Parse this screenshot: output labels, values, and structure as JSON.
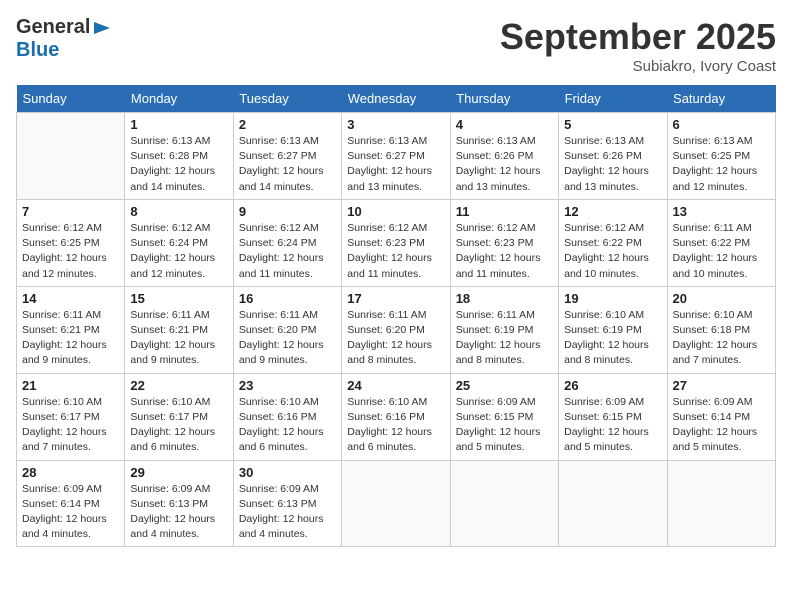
{
  "header": {
    "logo_general": "General",
    "logo_blue": "Blue",
    "month": "September 2025",
    "location": "Subiakro, Ivory Coast"
  },
  "weekdays": [
    "Sunday",
    "Monday",
    "Tuesday",
    "Wednesday",
    "Thursday",
    "Friday",
    "Saturday"
  ],
  "weeks": [
    [
      {
        "day": "",
        "info": ""
      },
      {
        "day": "1",
        "info": "Sunrise: 6:13 AM\nSunset: 6:28 PM\nDaylight: 12 hours\nand 14 minutes."
      },
      {
        "day": "2",
        "info": "Sunrise: 6:13 AM\nSunset: 6:27 PM\nDaylight: 12 hours\nand 14 minutes."
      },
      {
        "day": "3",
        "info": "Sunrise: 6:13 AM\nSunset: 6:27 PM\nDaylight: 12 hours\nand 13 minutes."
      },
      {
        "day": "4",
        "info": "Sunrise: 6:13 AM\nSunset: 6:26 PM\nDaylight: 12 hours\nand 13 minutes."
      },
      {
        "day": "5",
        "info": "Sunrise: 6:13 AM\nSunset: 6:26 PM\nDaylight: 12 hours\nand 13 minutes."
      },
      {
        "day": "6",
        "info": "Sunrise: 6:13 AM\nSunset: 6:25 PM\nDaylight: 12 hours\nand 12 minutes."
      }
    ],
    [
      {
        "day": "7",
        "info": "Sunrise: 6:12 AM\nSunset: 6:25 PM\nDaylight: 12 hours\nand 12 minutes."
      },
      {
        "day": "8",
        "info": "Sunrise: 6:12 AM\nSunset: 6:24 PM\nDaylight: 12 hours\nand 12 minutes."
      },
      {
        "day": "9",
        "info": "Sunrise: 6:12 AM\nSunset: 6:24 PM\nDaylight: 12 hours\nand 11 minutes."
      },
      {
        "day": "10",
        "info": "Sunrise: 6:12 AM\nSunset: 6:23 PM\nDaylight: 12 hours\nand 11 minutes."
      },
      {
        "day": "11",
        "info": "Sunrise: 6:12 AM\nSunset: 6:23 PM\nDaylight: 12 hours\nand 11 minutes."
      },
      {
        "day": "12",
        "info": "Sunrise: 6:12 AM\nSunset: 6:22 PM\nDaylight: 12 hours\nand 10 minutes."
      },
      {
        "day": "13",
        "info": "Sunrise: 6:11 AM\nSunset: 6:22 PM\nDaylight: 12 hours\nand 10 minutes."
      }
    ],
    [
      {
        "day": "14",
        "info": "Sunrise: 6:11 AM\nSunset: 6:21 PM\nDaylight: 12 hours\nand 9 minutes."
      },
      {
        "day": "15",
        "info": "Sunrise: 6:11 AM\nSunset: 6:21 PM\nDaylight: 12 hours\nand 9 minutes."
      },
      {
        "day": "16",
        "info": "Sunrise: 6:11 AM\nSunset: 6:20 PM\nDaylight: 12 hours\nand 9 minutes."
      },
      {
        "day": "17",
        "info": "Sunrise: 6:11 AM\nSunset: 6:20 PM\nDaylight: 12 hours\nand 8 minutes."
      },
      {
        "day": "18",
        "info": "Sunrise: 6:11 AM\nSunset: 6:19 PM\nDaylight: 12 hours\nand 8 minutes."
      },
      {
        "day": "19",
        "info": "Sunrise: 6:10 AM\nSunset: 6:19 PM\nDaylight: 12 hours\nand 8 minutes."
      },
      {
        "day": "20",
        "info": "Sunrise: 6:10 AM\nSunset: 6:18 PM\nDaylight: 12 hours\nand 7 minutes."
      }
    ],
    [
      {
        "day": "21",
        "info": "Sunrise: 6:10 AM\nSunset: 6:17 PM\nDaylight: 12 hours\nand 7 minutes."
      },
      {
        "day": "22",
        "info": "Sunrise: 6:10 AM\nSunset: 6:17 PM\nDaylight: 12 hours\nand 6 minutes."
      },
      {
        "day": "23",
        "info": "Sunrise: 6:10 AM\nSunset: 6:16 PM\nDaylight: 12 hours\nand 6 minutes."
      },
      {
        "day": "24",
        "info": "Sunrise: 6:10 AM\nSunset: 6:16 PM\nDaylight: 12 hours\nand 6 minutes."
      },
      {
        "day": "25",
        "info": "Sunrise: 6:09 AM\nSunset: 6:15 PM\nDaylight: 12 hours\nand 5 minutes."
      },
      {
        "day": "26",
        "info": "Sunrise: 6:09 AM\nSunset: 6:15 PM\nDaylight: 12 hours\nand 5 minutes."
      },
      {
        "day": "27",
        "info": "Sunrise: 6:09 AM\nSunset: 6:14 PM\nDaylight: 12 hours\nand 5 minutes."
      }
    ],
    [
      {
        "day": "28",
        "info": "Sunrise: 6:09 AM\nSunset: 6:14 PM\nDaylight: 12 hours\nand 4 minutes."
      },
      {
        "day": "29",
        "info": "Sunrise: 6:09 AM\nSunset: 6:13 PM\nDaylight: 12 hours\nand 4 minutes."
      },
      {
        "day": "30",
        "info": "Sunrise: 6:09 AM\nSunset: 6:13 PM\nDaylight: 12 hours\nand 4 minutes."
      },
      {
        "day": "",
        "info": ""
      },
      {
        "day": "",
        "info": ""
      },
      {
        "day": "",
        "info": ""
      },
      {
        "day": "",
        "info": ""
      }
    ]
  ]
}
